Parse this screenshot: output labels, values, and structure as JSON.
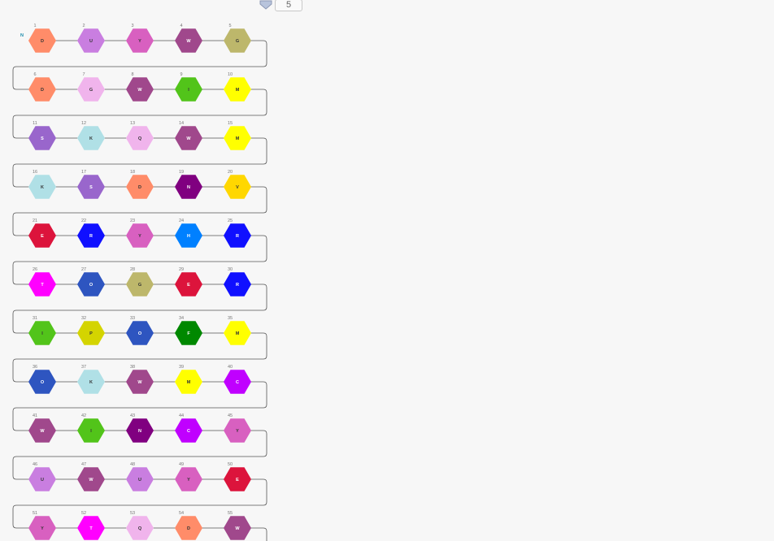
{
  "toolbar": {
    "page_value": "5",
    "arrow_icon": "chevron-down-icon"
  },
  "terminus_label": "N",
  "residues": [
    {
      "n": "1",
      "l": "D",
      "c": "#ff8c69"
    },
    {
      "n": "2",
      "l": "U",
      "c": "#c97ee0"
    },
    {
      "n": "3",
      "l": "Y",
      "c": "#d860c0"
    },
    {
      "n": "4",
      "l": "W",
      "c": "#a0488c"
    },
    {
      "n": "5",
      "l": "G",
      "c": "#bdb76b"
    },
    {
      "n": "6",
      "l": "D",
      "c": "#ff8c69"
    },
    {
      "n": "7",
      "l": "G",
      "c": "#f0b4ec"
    },
    {
      "n": "8",
      "l": "W",
      "c": "#a0488c"
    },
    {
      "n": "9",
      "l": "I",
      "c": "#52c41a"
    },
    {
      "n": "10",
      "l": "M",
      "c": "#ffff00"
    },
    {
      "n": "11",
      "l": "S",
      "c": "#9966cc"
    },
    {
      "n": "12",
      "l": "K",
      "c": "#b0e0e6"
    },
    {
      "n": "13",
      "l": "Q",
      "c": "#f0b4ec"
    },
    {
      "n": "14",
      "l": "W",
      "c": "#a0488c"
    },
    {
      "n": "15",
      "l": "M",
      "c": "#ffff00"
    },
    {
      "n": "16",
      "l": "K",
      "c": "#b0e0e6"
    },
    {
      "n": "17",
      "l": "S",
      "c": "#9966cc"
    },
    {
      "n": "18",
      "l": "D",
      "c": "#ff8c69"
    },
    {
      "n": "19",
      "l": "N",
      "c": "#800080"
    },
    {
      "n": "20",
      "l": "V",
      "c": "#ffd700"
    },
    {
      "n": "21",
      "l": "E",
      "c": "#dc143c"
    },
    {
      "n": "22",
      "l": "R",
      "c": "#1010ff"
    },
    {
      "n": "23",
      "l": "Y",
      "c": "#d860c0"
    },
    {
      "n": "24",
      "l": "H",
      "c": "#0080ff"
    },
    {
      "n": "25",
      "l": "R",
      "c": "#1010ff"
    },
    {
      "n": "26",
      "l": "T",
      "c": "#ff00ff"
    },
    {
      "n": "27",
      "l": "O",
      "c": "#2e55c0"
    },
    {
      "n": "28",
      "l": "G",
      "c": "#bdb76b"
    },
    {
      "n": "29",
      "l": "E",
      "c": "#dc143c"
    },
    {
      "n": "30",
      "l": "R",
      "c": "#1010ff"
    },
    {
      "n": "31",
      "l": "I",
      "c": "#52c41a"
    },
    {
      "n": "32",
      "l": "P",
      "c": "#d4d400"
    },
    {
      "n": "33",
      "l": "O",
      "c": "#2e55c0"
    },
    {
      "n": "34",
      "l": "F",
      "c": "#008800"
    },
    {
      "n": "35",
      "l": "M",
      "c": "#ffff00"
    },
    {
      "n": "36",
      "l": "O",
      "c": "#2e55c0"
    },
    {
      "n": "37",
      "l": "K",
      "c": "#b0e0e6"
    },
    {
      "n": "38",
      "l": "W",
      "c": "#a0488c"
    },
    {
      "n": "39",
      "l": "M",
      "c": "#ffff00"
    },
    {
      "n": "40",
      "l": "C",
      "c": "#c000ff"
    },
    {
      "n": "41",
      "l": "W",
      "c": "#a0488c"
    },
    {
      "n": "42",
      "l": "I",
      "c": "#52c41a"
    },
    {
      "n": "43",
      "l": "N",
      "c": "#800080"
    },
    {
      "n": "44",
      "l": "C",
      "c": "#c000ff"
    },
    {
      "n": "45",
      "l": "Y",
      "c": "#d860c0"
    },
    {
      "n": "46",
      "l": "U",
      "c": "#c97ee0"
    },
    {
      "n": "47",
      "l": "W",
      "c": "#a0488c"
    },
    {
      "n": "48",
      "l": "U",
      "c": "#c97ee0"
    },
    {
      "n": "49",
      "l": "Y",
      "c": "#d860c0"
    },
    {
      "n": "50",
      "l": "E",
      "c": "#dc143c"
    },
    {
      "n": "51",
      "l": "Y",
      "c": "#d860c0"
    },
    {
      "n": "52",
      "l": "T",
      "c": "#ff00ff"
    },
    {
      "n": "53",
      "l": "Q",
      "c": "#f0b4ec"
    },
    {
      "n": "54",
      "l": "D",
      "c": "#ff8c69"
    },
    {
      "n": "55",
      "l": "W",
      "c": "#a0488c"
    }
  ]
}
